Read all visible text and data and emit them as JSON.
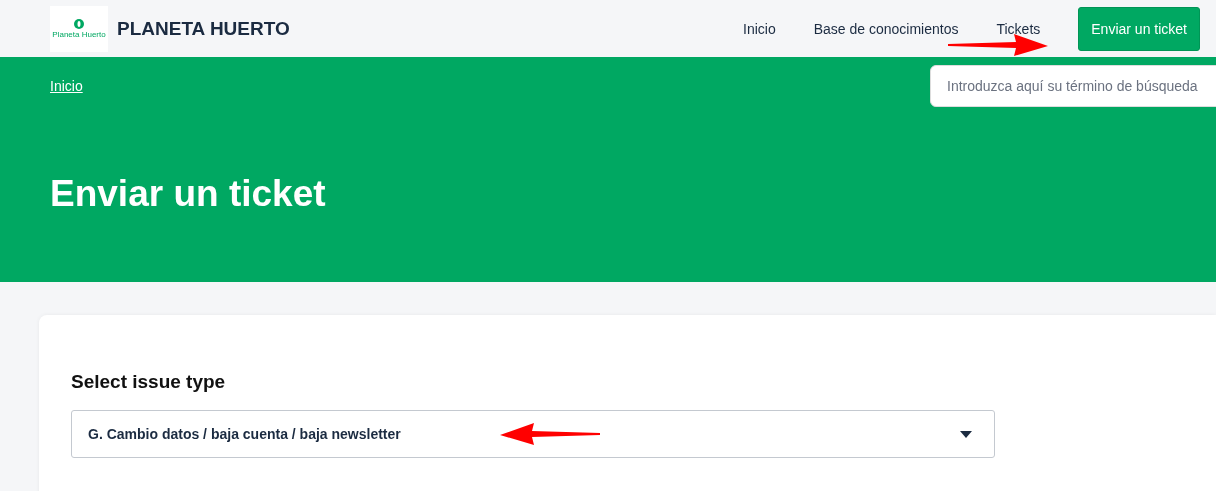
{
  "header": {
    "logo_text": "Planeta Huerto",
    "site_name": "PLANETA HUERTO",
    "nav": [
      {
        "label": "Inicio",
        "kind": "link"
      },
      {
        "label": "Base de conocimientos",
        "kind": "link"
      },
      {
        "label": "Tickets",
        "kind": "link"
      },
      {
        "label": "Enviar un ticket",
        "kind": "button"
      }
    ]
  },
  "hero": {
    "breadcrumb": "Inicio",
    "search": {
      "placeholder": "Introduzca aquí su término de búsqueda"
    },
    "title": "Enviar un ticket"
  },
  "form": {
    "label": "Select issue type",
    "select": {
      "value": "G. Cambio datos / baja cuenta / baja newsletter"
    }
  }
}
